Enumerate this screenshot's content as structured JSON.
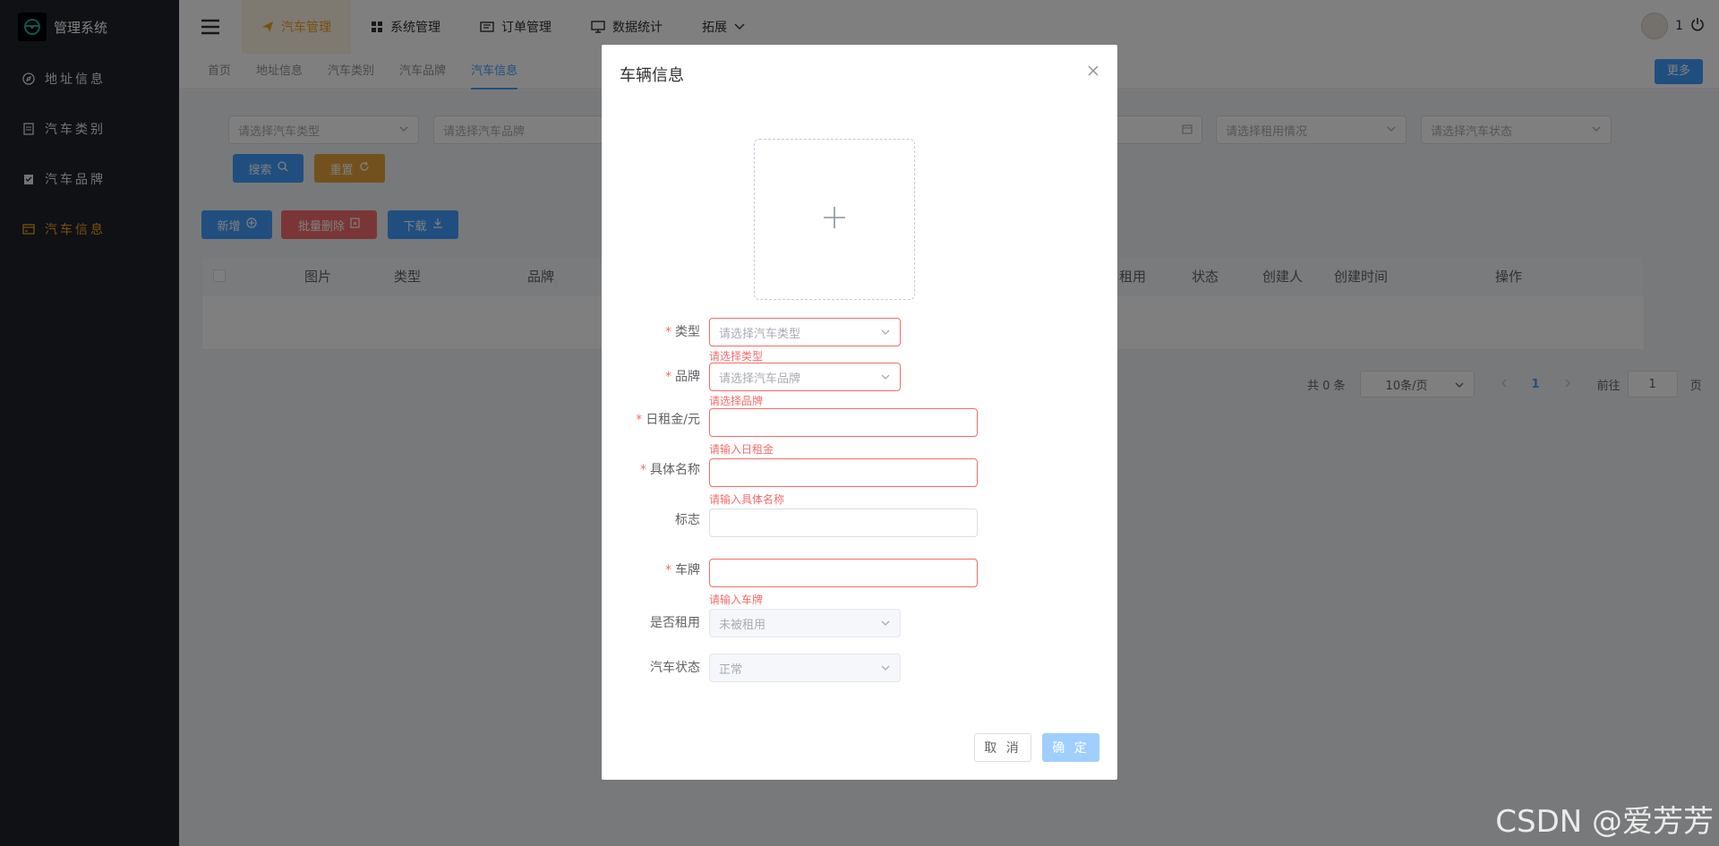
{
  "app": {
    "title": "管理系统"
  },
  "sidebar": {
    "items": [
      {
        "label": "地址信息",
        "icon": "compass-icon",
        "active": false
      },
      {
        "label": "汽车类别",
        "icon": "document-icon",
        "active": false
      },
      {
        "label": "汽车品牌",
        "icon": "clipboard-check-icon",
        "active": false
      },
      {
        "label": "汽车信息",
        "icon": "credit-card-icon",
        "active": true
      }
    ]
  },
  "header": {
    "nav": [
      {
        "label": "汽车管理",
        "icon": "send-icon",
        "active": true
      },
      {
        "label": "系统管理",
        "icon": "grid-icon",
        "active": false
      },
      {
        "label": "订单管理",
        "icon": "tickets-icon",
        "active": false
      },
      {
        "label": "数据统计",
        "icon": "monitor-icon",
        "active": false
      },
      {
        "label": "拓展",
        "icon": "chevron-down-icon",
        "active": false
      }
    ],
    "user_count": "1"
  },
  "tags": {
    "items": [
      "首页",
      "地址信息",
      "汽车类别",
      "汽车品牌",
      "汽车信息"
    ],
    "more_label": "更多"
  },
  "filters": {
    "type_placeholder": "请选择汽车类型",
    "brand_placeholder": "请选择汽车品牌",
    "rent_placeholder": "请选择租用情况",
    "status_placeholder": "请选择汽车状态",
    "search_label": "搜索",
    "reset_label": "重置"
  },
  "actions": {
    "add_label": "新增",
    "batch_delete_label": "批量删除",
    "download_label": "下载"
  },
  "table": {
    "columns": [
      "图片",
      "类型",
      "品牌",
      "租用",
      "状态",
      "创建人",
      "创建时间",
      "操作"
    ]
  },
  "pagination": {
    "total": "共 0 条",
    "page_size": "10条/页",
    "current_page": "1",
    "goto_label": "前往",
    "goto_value": "1",
    "page_suffix": "页"
  },
  "dialog": {
    "title": "车辆信息",
    "fields": {
      "type": {
        "label": "类型",
        "placeholder": "请选择汽车类型",
        "error": "请选择类型"
      },
      "brand": {
        "label": "品牌",
        "placeholder": "请选择汽车品牌",
        "error": "请选择品牌"
      },
      "rent": {
        "label": "日租金/元",
        "value": "",
        "error": "请输入日租金"
      },
      "name": {
        "label": "具体名称",
        "value": "",
        "error": "请输入具体名称"
      },
      "sign": {
        "label": "标志",
        "value": ""
      },
      "plate": {
        "label": "车牌",
        "value": "",
        "error": "请输入车牌"
      },
      "rented": {
        "label": "是否租用",
        "value": "未被租用"
      },
      "status": {
        "label": "汽车状态",
        "value": "正常"
      }
    },
    "cancel_label": "取 消",
    "confirm_label": "确 定"
  },
  "watermark": "CSDN @爱芳芳",
  "colors": {
    "primary": "#409eff",
    "warning": "#e6a23c",
    "danger": "#f56c6c",
    "sidebar_bg": "#1e222b",
    "sidebar_active": "#f0a020"
  }
}
